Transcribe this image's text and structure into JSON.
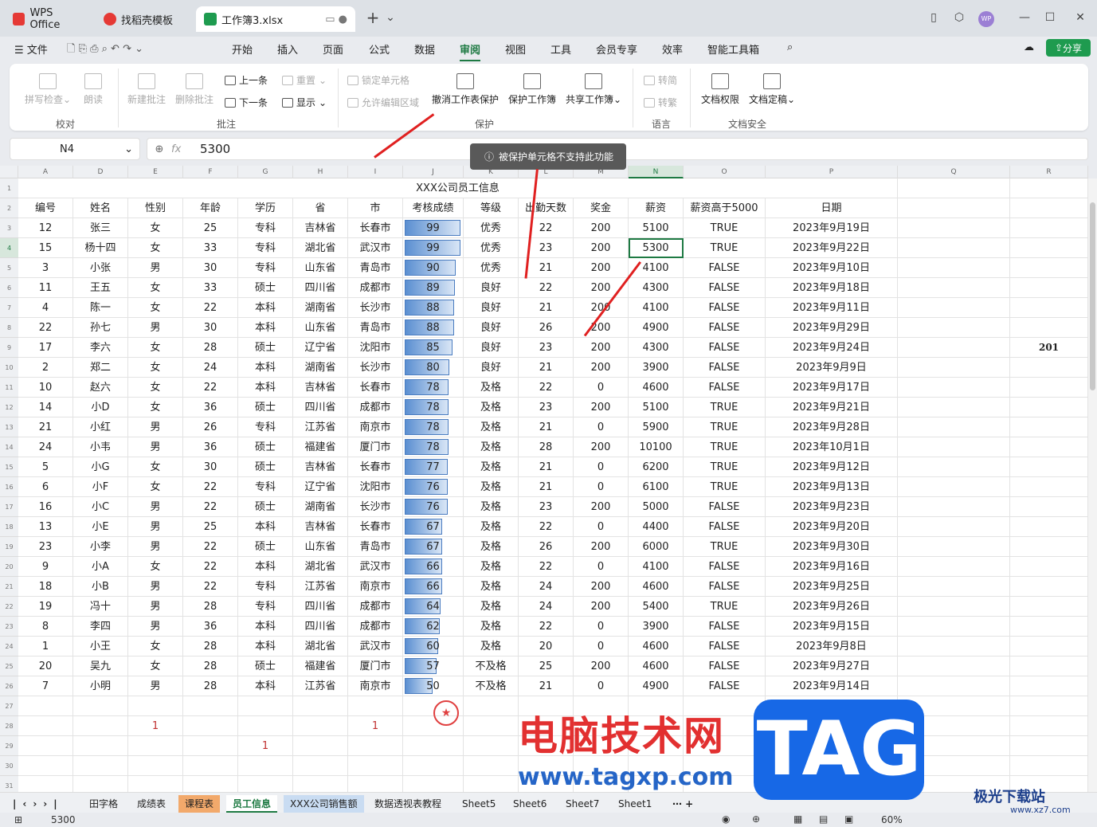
{
  "titlebar": {
    "tabs": [
      {
        "label": "WPS Office"
      },
      {
        "label": "找稻壳模板"
      },
      {
        "label": "工作簿3.xlsx"
      }
    ],
    "add_tab": "+",
    "avatar": "WP"
  },
  "menubar": {
    "file": "文件",
    "items": [
      "开始",
      "插入",
      "页面",
      "公式",
      "数据",
      "审阅",
      "视图",
      "工具",
      "会员专享",
      "效率",
      "智能工具箱"
    ],
    "active": "审阅",
    "share": "分享"
  },
  "ribbon": {
    "proof": {
      "spell": "拼写检查",
      "read": "朗读",
      "group": "校对"
    },
    "comment": {
      "new": "新建批注",
      "delete": "删除批注",
      "prev": "上一条",
      "next": "下一条",
      "reset": "重置",
      "show": "显示",
      "group": "批注"
    },
    "protect": {
      "lock": "锁定单元格",
      "allow": "允许编辑区域",
      "unprotect": "撤消工作表保护",
      "protect_book": "保护工作簿",
      "share_book": "共享工作簿",
      "group": "保护"
    },
    "lang": {
      "to_simp": "转简",
      "to_trad": "转繁",
      "group": "语言"
    },
    "docsec": {
      "perm": "文档权限",
      "final": "文档定稿",
      "group": "文档安全"
    }
  },
  "formula": {
    "cell_ref": "N4",
    "fx": "fx",
    "value": "5300"
  },
  "tooltip": "被保护单元格不支持此功能",
  "columns": [
    "A",
    "D",
    "E",
    "F",
    "G",
    "H",
    "I",
    "J",
    "K",
    "L",
    "M",
    "N",
    "O",
    "P",
    "Q",
    "R"
  ],
  "sheet_title": "XXX公司员工信息",
  "headers": [
    "编号",
    "姓名",
    "性别",
    "年龄",
    "学历",
    "省",
    "市",
    "考核成绩",
    "等级",
    "出勤天数",
    "奖金",
    "薪资",
    "薪资高于5000",
    "日期"
  ],
  "rows": [
    [
      "12",
      "张三",
      "女",
      "25",
      "专科",
      "吉林省",
      "长春市",
      "99",
      "优秀",
      "22",
      "200",
      "5100",
      "TRUE",
      "2023年9月19日"
    ],
    [
      "15",
      "杨十四",
      "女",
      "33",
      "专科",
      "湖北省",
      "武汉市",
      "99",
      "优秀",
      "23",
      "200",
      "5300",
      "TRUE",
      "2023年9月22日"
    ],
    [
      "3",
      "小张",
      "男",
      "30",
      "专科",
      "山东省",
      "青岛市",
      "90",
      "优秀",
      "21",
      "200",
      "4100",
      "FALSE",
      "2023年9月10日"
    ],
    [
      "11",
      "王五",
      "女",
      "33",
      "硕士",
      "四川省",
      "成都市",
      "89",
      "良好",
      "22",
      "200",
      "4300",
      "FALSE",
      "2023年9月18日"
    ],
    [
      "4",
      "陈一",
      "女",
      "22",
      "本科",
      "湖南省",
      "长沙市",
      "88",
      "良好",
      "21",
      "200",
      "4100",
      "FALSE",
      "2023年9月11日"
    ],
    [
      "22",
      "孙七",
      "男",
      "30",
      "本科",
      "山东省",
      "青岛市",
      "88",
      "良好",
      "26",
      "200",
      "4900",
      "FALSE",
      "2023年9月29日"
    ],
    [
      "17",
      "李六",
      "女",
      "28",
      "硕士",
      "辽宁省",
      "沈阳市",
      "85",
      "良好",
      "23",
      "200",
      "4300",
      "FALSE",
      "2023年9月24日"
    ],
    [
      "2",
      "郑二",
      "女",
      "24",
      "本科",
      "湖南省",
      "长沙市",
      "80",
      "良好",
      "21",
      "200",
      "3900",
      "FALSE",
      "2023年9月9日"
    ],
    [
      "10",
      "赵六",
      "女",
      "22",
      "本科",
      "吉林省",
      "长春市",
      "78",
      "及格",
      "22",
      "0",
      "4600",
      "FALSE",
      "2023年9月17日"
    ],
    [
      "14",
      "小D",
      "女",
      "36",
      "硕士",
      "四川省",
      "成都市",
      "78",
      "及格",
      "23",
      "200",
      "5100",
      "TRUE",
      "2023年9月21日"
    ],
    [
      "21",
      "小红",
      "男",
      "26",
      "专科",
      "江苏省",
      "南京市",
      "78",
      "及格",
      "21",
      "0",
      "5900",
      "TRUE",
      "2023年9月28日"
    ],
    [
      "24",
      "小韦",
      "男",
      "36",
      "硕士",
      "福建省",
      "厦门市",
      "78",
      "及格",
      "28",
      "200",
      "10100",
      "TRUE",
      "2023年10月1日"
    ],
    [
      "5",
      "小G",
      "女",
      "30",
      "硕士",
      "吉林省",
      "长春市",
      "77",
      "及格",
      "21",
      "0",
      "6200",
      "TRUE",
      "2023年9月12日"
    ],
    [
      "6",
      "小F",
      "女",
      "22",
      "专科",
      "辽宁省",
      "沈阳市",
      "76",
      "及格",
      "21",
      "0",
      "6100",
      "TRUE",
      "2023年9月13日"
    ],
    [
      "16",
      "小C",
      "男",
      "22",
      "硕士",
      "湖南省",
      "长沙市",
      "76",
      "及格",
      "23",
      "200",
      "5000",
      "FALSE",
      "2023年9月23日"
    ],
    [
      "13",
      "小E",
      "男",
      "25",
      "本科",
      "吉林省",
      "长春市",
      "67",
      "及格",
      "22",
      "0",
      "4400",
      "FALSE",
      "2023年9月20日"
    ],
    [
      "23",
      "小李",
      "男",
      "22",
      "硕士",
      "山东省",
      "青岛市",
      "67",
      "及格",
      "26",
      "200",
      "6000",
      "TRUE",
      "2023年9月30日"
    ],
    [
      "9",
      "小A",
      "女",
      "22",
      "本科",
      "湖北省",
      "武汉市",
      "66",
      "及格",
      "22",
      "0",
      "4100",
      "FALSE",
      "2023年9月16日"
    ],
    [
      "18",
      "小B",
      "男",
      "22",
      "专科",
      "江苏省",
      "南京市",
      "66",
      "及格",
      "24",
      "200",
      "4600",
      "FALSE",
      "2023年9月25日"
    ],
    [
      "19",
      "冯十",
      "男",
      "28",
      "专科",
      "四川省",
      "成都市",
      "64",
      "及格",
      "24",
      "200",
      "5400",
      "TRUE",
      "2023年9月26日"
    ],
    [
      "8",
      "李四",
      "男",
      "36",
      "本科",
      "四川省",
      "成都市",
      "62",
      "及格",
      "22",
      "0",
      "3900",
      "FALSE",
      "2023年9月15日"
    ],
    [
      "1",
      "小王",
      "女",
      "28",
      "本科",
      "湖北省",
      "武汉市",
      "60",
      "及格",
      "20",
      "0",
      "4600",
      "FALSE",
      "2023年9月8日"
    ],
    [
      "20",
      "吴九",
      "女",
      "28",
      "硕士",
      "福建省",
      "厦门市",
      "57",
      "不及格",
      "25",
      "200",
      "4600",
      "FALSE",
      "2023年9月27日"
    ],
    [
      "7",
      "小明",
      "男",
      "28",
      "本科",
      "江苏省",
      "南京市",
      "50",
      "不及格",
      "21",
      "0",
      "4900",
      "FALSE",
      "2023年9月14日"
    ]
  ],
  "extra": {
    "r9": "201",
    "e28": "1",
    "i28": "1",
    "g29": "1"
  },
  "sheet_tabs": [
    "田字格",
    "成绩表",
    "课程表",
    "员工信息",
    "XXX公司销售额",
    "数据透视表教程",
    "Sheet5",
    "Sheet6",
    "Sheet7",
    "Sheet1"
  ],
  "active_sheet": "员工信息",
  "status": {
    "value": "5300",
    "zoom": "60%"
  },
  "watermark": {
    "text": "电脑技术网",
    "url": "www.tagxp.com",
    "tag": "TAG",
    "brand": "极光下载站",
    "brand_url": "www.xz7.com"
  },
  "colors": {
    "accent": "#1e7a43",
    "bar": "#5b8fd1",
    "red": "#e02020"
  }
}
